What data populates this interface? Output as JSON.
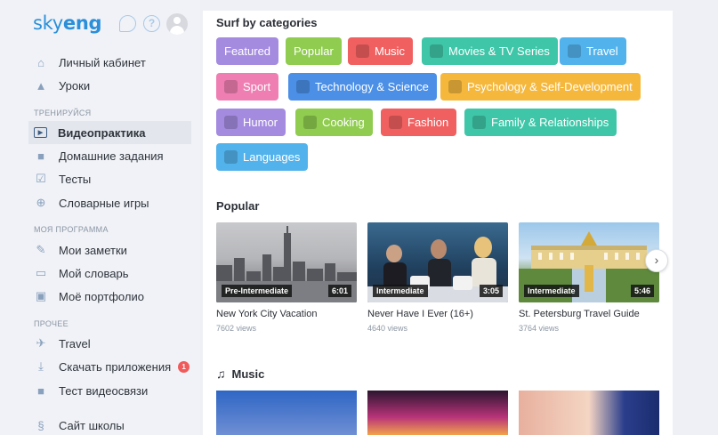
{
  "logo": {
    "text_a": "sky",
    "text_b": "eng"
  },
  "colors": {
    "accent": "#2b8fd9",
    "sidebar_bg": "#f0f2f7",
    "badge": "#f05a5a"
  },
  "sidebar": {
    "items_top": [
      {
        "label": "Личный кабинет",
        "icon": "home-icon"
      },
      {
        "label": "Уроки",
        "icon": "graduation-cap-icon"
      }
    ],
    "section_train": "ТРЕНИРУЙСЯ",
    "items_train": [
      {
        "label": "Видеопрактика",
        "icon": "play-icon",
        "active": true
      },
      {
        "label": "Домашние задания",
        "icon": "briefcase-icon"
      },
      {
        "label": "Тесты",
        "icon": "checkbox-icon"
      },
      {
        "label": "Словарные игры",
        "icon": "gamepad-icon"
      }
    ],
    "section_program": "МОЯ ПРОГРАММА",
    "items_program": [
      {
        "label": "Мои заметки",
        "icon": "pen-icon"
      },
      {
        "label": "Мой словарь",
        "icon": "book-icon"
      },
      {
        "label": "Моё портфолио",
        "icon": "portfolio-icon"
      }
    ],
    "section_other": "ПРОЧЕЕ",
    "items_other": [
      {
        "label": "Travel",
        "icon": "plane-icon"
      },
      {
        "label": "Скачать приложения",
        "icon": "download-icon",
        "badge": "1"
      },
      {
        "label": "Тест видеосвязи",
        "icon": "video-camera-icon"
      },
      {
        "label": "Сайт школы",
        "icon": "site-icon"
      }
    ]
  },
  "categories": {
    "title": "Surf by categories",
    "chips": [
      {
        "label": "Featured",
        "color": "#a48be0"
      },
      {
        "label": "Popular",
        "color": "#8fcc4f"
      },
      {
        "label": "Music",
        "color": "#f06060"
      },
      {
        "label": "Movies & TV Series",
        "color": "#3fc6a8"
      },
      {
        "label": "Travel",
        "color": "#52b3ec"
      },
      {
        "label": "Sport",
        "color": "#ef7fb2"
      },
      {
        "label": "Technology & Science",
        "color": "#4b8fe6"
      },
      {
        "label": "Psychology & Self-Development",
        "color": "#f5b83d"
      },
      {
        "label": "Humor",
        "color": "#a48be0"
      },
      {
        "label": "Cooking",
        "color": "#8fcc4f"
      },
      {
        "label": "Fashion",
        "color": "#f06060"
      },
      {
        "label": "Family & Relationships",
        "color": "#3fc6a8"
      },
      {
        "label": "Languages",
        "color": "#52b3ec"
      }
    ]
  },
  "popular": {
    "title": "Popular",
    "videos": [
      {
        "level": "Pre-Intermediate",
        "duration": "6:01",
        "title": "New York City Vacation",
        "views": "7602 views"
      },
      {
        "level": "Intermediate",
        "duration": "3:05",
        "title": "Never Have I Ever (16+)",
        "views": "4640 views"
      },
      {
        "level": "Intermediate",
        "duration": "5:46",
        "title": "St. Petersburg Travel Guide",
        "views": "3764 views"
      }
    ],
    "next_label": "›"
  },
  "music": {
    "title": "Music"
  }
}
